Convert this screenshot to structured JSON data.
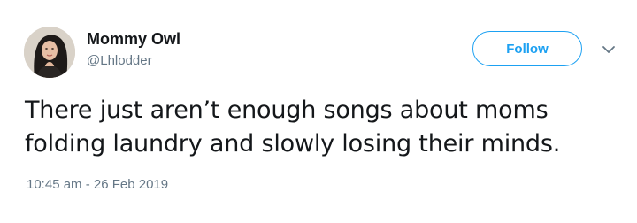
{
  "author": {
    "display_name": "Mommy Owl",
    "handle": "@Lhlodder"
  },
  "actions": {
    "follow_label": "Follow",
    "more_icon": "chevron-down-icon"
  },
  "tweet": {
    "lines": [
      "There just aren’t enough songs about moms",
      "folding laundry and slowly losing their minds."
    ],
    "timestamp": "10:45 am - 26 Feb 2019"
  },
  "colors": {
    "accent": "#1da1f2",
    "text": "#14171a",
    "secondary": "#657786"
  }
}
